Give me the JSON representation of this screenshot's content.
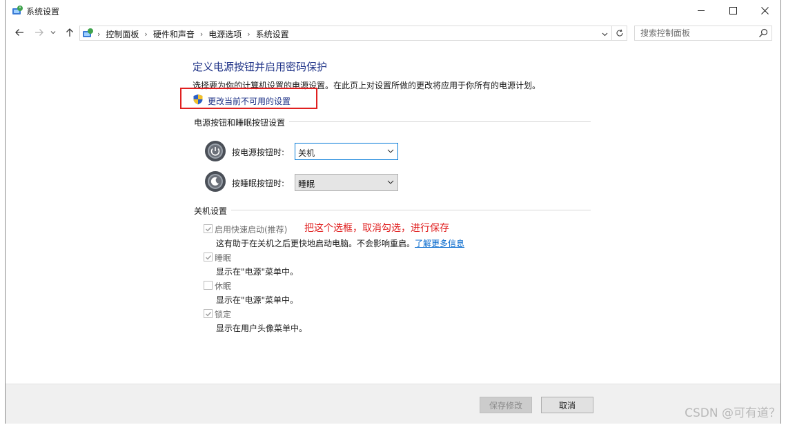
{
  "window": {
    "title": "系统设置"
  },
  "nav": {
    "breadcrumbs": [
      "控制面板",
      "硬件和声音",
      "电源选项",
      "系统设置"
    ],
    "search_placeholder": "搜索控制面板"
  },
  "content": {
    "heading": "定义电源按钮并启用密码保护",
    "description": "选择要为你的计算机设置的电源设置。在此页上对设置所做的更改将应用于你所有的电源计划。",
    "change_link": "更改当前不可用的设置",
    "power_group": {
      "title": "电源按钮和睡眠按钮设置",
      "power_label": "按电源按钮时:",
      "power_value": "关机",
      "sleep_label": "按睡眠按钮时:",
      "sleep_value": "睡眠"
    },
    "shutdown_group": {
      "title": "关机设置",
      "items": [
        {
          "label": "启用快速启动(推荐)",
          "checked": true,
          "desc": "这有助于在关机之后更快地启动电脑。不会影响重启。",
          "link": "了解更多信息"
        },
        {
          "label": "睡眠",
          "checked": true,
          "desc": "显示在\"电源\"菜单中。"
        },
        {
          "label": "休眠",
          "checked": false,
          "desc": "显示在\"电源\"菜单中。"
        },
        {
          "label": "锁定",
          "checked": true,
          "desc": "显示在用户头像菜单中。"
        }
      ]
    },
    "annotation": "把这个选框，取消勾选，进行保存"
  },
  "footer": {
    "save_label": "保存修改",
    "cancel_label": "取消"
  },
  "watermark": "CSDN @可有道？",
  "colors": {
    "heading": "#1e3287",
    "highlight": "#e02020",
    "link": "#0066cc",
    "focus": "#0078d7"
  }
}
